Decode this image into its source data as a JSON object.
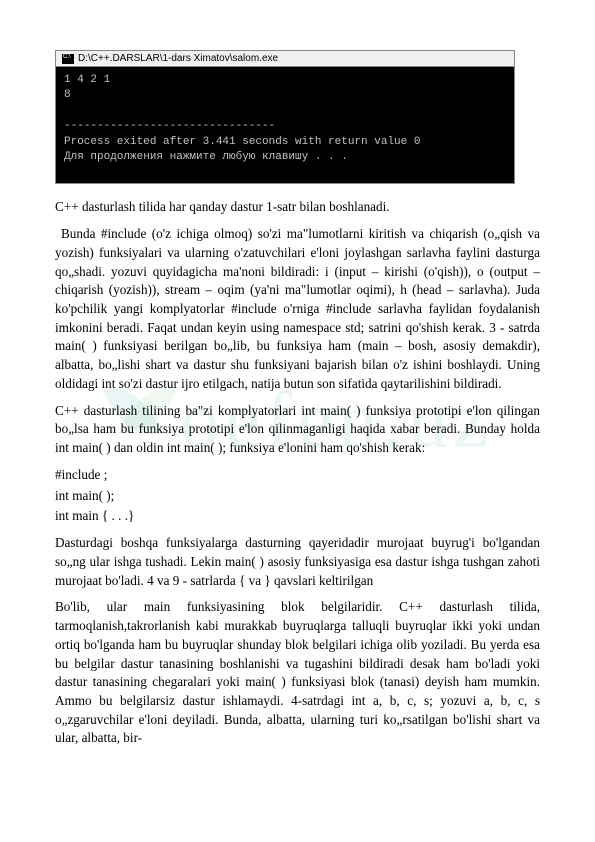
{
  "watermark": "oefen.uz",
  "console": {
    "title_path": "D:\\C++.DARSLAR\\1-dars Ximatov\\salom.exe",
    "line1": "1 4 2 1",
    "line2": "8",
    "blank": "",
    "dashes": "--------------------------------",
    "line_process": "Process exited after 3.441 seconds with return value 0",
    "line_press": "Для продолжения нажмите любую клавишу . . ."
  },
  "paragraphs": {
    "p1": "C++ dasturlash tilida har qanday dastur 1-satr bilan boshlanadi.",
    "p2": " Bunda #include (o'z ichiga olmoq) so'zi ma\"lumotlarni kiritish va chiqarish (o„qish va yozish) funksiyalari va ularning o'zatuvchilari e'loni joylashgan sarlavha faylini dasturga qo„shadi. yozuvi quyidagicha ma'noni bildiradi: i (input – kirishi (o'qish)), o (output – chiqarish (yozish)), stream – oqim (ya'ni ma\"lumotlar oqimi), h (head – sarlavha). Juda ko'pchilik yangi komplyatorlar #include o'rniga #include sarlavha faylidan foydalanish imkonini beradi. Faqat undan keyin using namespace std; satrini qo'shish kerak. 3 - satrda main( ) funksiyasi berilgan bo„lib, bu funksiya ham (main – bosh, asosiy demakdir), albatta, bo„lishi shart va dastur shu funksiyani bajarish bilan o'z ishini boshlaydi. Uning oldidagi int so'zi dastur ijro etilgach, natija butun son sifatida qaytarilishini bildiradi.",
    "p3": "  C++ dasturlash tilining ba\"zi komplyatorlari int main( ) funksiya prototipi e'lon qilingan bo„lsa ham bu funksiya prototipi e'lon qilinmaganligi haqida xabar beradi. Bunday holda int main( ) dan oldin int main( ); funksiya e'lonini ham qo'shish kerak:",
    "code1": "#include ;",
    "code2": "int main( );",
    "code3": " int main { . . .}",
    "p4": "Dasturdagi boshqa funksiyalarga dasturning qayeridadir murojaat buyrug'i bo'lgandan so„ng ular ishga tushadi. Lekin main( ) asosiy funksiyasiga esa dastur ishga tushgan zahoti murojaat bo'ladi. 4 va 9 - satrlarda {  va  } qavslari keltirilgan",
    "p5": "Bo'lib, ular main funksiyasining blok belgilaridir. C++ dasturlash tilida, tarmoqlanish,takrorlanish kabi murakkab buyruqlarga talluqli buyruqlar ikki yoki undan ortiq bo'lganda ham bu buyruqlar shunday blok belgilari ichiga olib yoziladi. Bu yerda esa bu belgilar dastur tanasining boshlanishi va tugashini bildiradi desak ham bo'ladi yoki dastur tanasining chegaralari yoki main( ) funksiyasi blok (tanasi) deyish ham mumkin. Ammo bu belgilarsiz dastur ishlamaydi. 4-satrdagi int a, b, c, s; yozuvi a, b, c, s o„zgaruvchilar e'loni deyiladi. Bunda, albatta, ularning turi ko„rsatilgan bo'lishi shart va ular, albatta, bir-"
  }
}
